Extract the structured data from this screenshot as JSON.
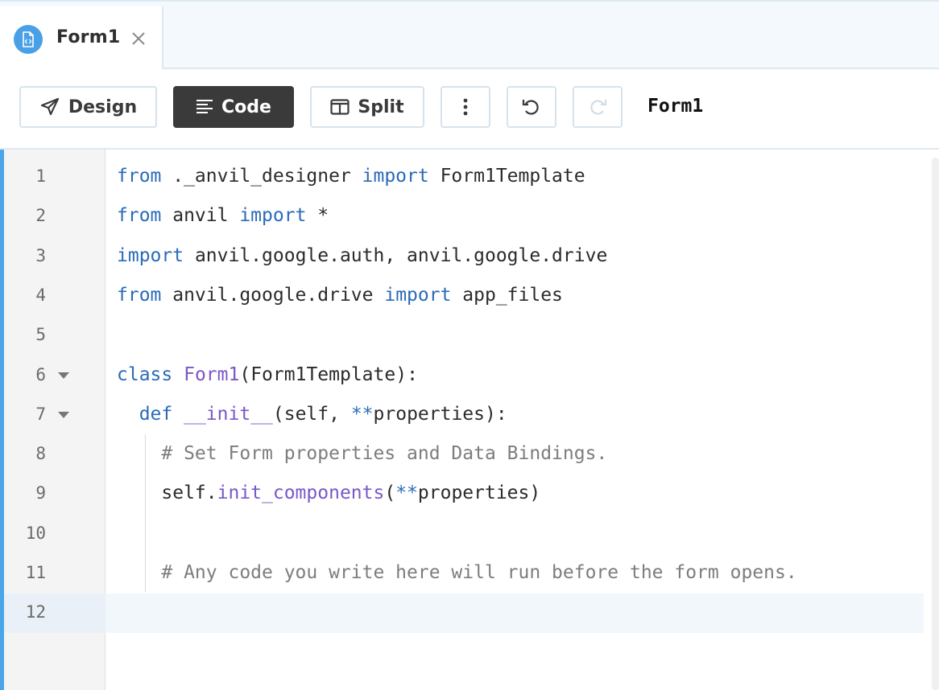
{
  "tab": {
    "title": "Form1",
    "icon": "code-file-icon",
    "close_icon": "close-icon"
  },
  "toolbar": {
    "design_label": "Design",
    "code_label": "Code",
    "split_label": "Split",
    "more_icon": "more-vertical-icon",
    "undo_icon": "undo-icon",
    "redo_icon": "redo-icon",
    "active_mode": "Code",
    "form_name": "Form1"
  },
  "colors": {
    "accent": "#4aa6e8",
    "keyword": "#2a6bb8",
    "function": "#7a57c8",
    "comment": "#7d7d7d",
    "active_button": "#3a3a3a"
  },
  "editor": {
    "current_line": 12,
    "lines": [
      {
        "number": "1",
        "fold": false,
        "tokens": [
          {
            "t": "from",
            "c": "kw"
          },
          {
            "t": " ._anvil_designer ",
            "c": ""
          },
          {
            "t": "import",
            "c": "kw"
          },
          {
            "t": " Form1Template",
            "c": ""
          }
        ]
      },
      {
        "number": "2",
        "fold": false,
        "tokens": [
          {
            "t": "from",
            "c": "kw"
          },
          {
            "t": " anvil ",
            "c": ""
          },
          {
            "t": "import",
            "c": "kw"
          },
          {
            "t": " *",
            "c": ""
          }
        ]
      },
      {
        "number": "3",
        "fold": false,
        "tokens": [
          {
            "t": "import",
            "c": "kw"
          },
          {
            "t": " anvil.google.auth, anvil.google.drive",
            "c": ""
          }
        ]
      },
      {
        "number": "4",
        "fold": false,
        "tokens": [
          {
            "t": "from",
            "c": "kw"
          },
          {
            "t": " anvil.google.drive ",
            "c": ""
          },
          {
            "t": "import",
            "c": "kw"
          },
          {
            "t": " app_files",
            "c": ""
          }
        ]
      },
      {
        "number": "5",
        "fold": false,
        "tokens": []
      },
      {
        "number": "6",
        "fold": true,
        "tokens": [
          {
            "t": "class",
            "c": "kw"
          },
          {
            "t": " ",
            "c": ""
          },
          {
            "t": "Form1",
            "c": "fn"
          },
          {
            "t": "(Form1Template):",
            "c": ""
          }
        ]
      },
      {
        "number": "7",
        "fold": true,
        "tokens": [
          {
            "t": "  ",
            "c": ""
          },
          {
            "t": "def",
            "c": "kw"
          },
          {
            "t": " ",
            "c": ""
          },
          {
            "t": "__init__",
            "c": "fn"
          },
          {
            "t": "(self, ",
            "c": ""
          },
          {
            "t": "**",
            "c": "kw"
          },
          {
            "t": "properties):",
            "c": ""
          }
        ]
      },
      {
        "number": "8",
        "fold": false,
        "tokens": [
          {
            "t": "    ",
            "c": ""
          },
          {
            "t": "# Set Form properties and Data Bindings.",
            "c": "cm"
          }
        ]
      },
      {
        "number": "9",
        "fold": false,
        "tokens": [
          {
            "t": "    self.",
            "c": ""
          },
          {
            "t": "init_components",
            "c": "fn"
          },
          {
            "t": "(",
            "c": ""
          },
          {
            "t": "**",
            "c": "kw"
          },
          {
            "t": "properties)",
            "c": ""
          }
        ]
      },
      {
        "number": "10",
        "fold": false,
        "tokens": []
      },
      {
        "number": "11",
        "fold": false,
        "tokens": [
          {
            "t": "    ",
            "c": ""
          },
          {
            "t": "# Any code you write here will run before the form opens.",
            "c": "cm"
          }
        ]
      },
      {
        "number": "12",
        "fold": false,
        "tokens": []
      }
    ]
  }
}
